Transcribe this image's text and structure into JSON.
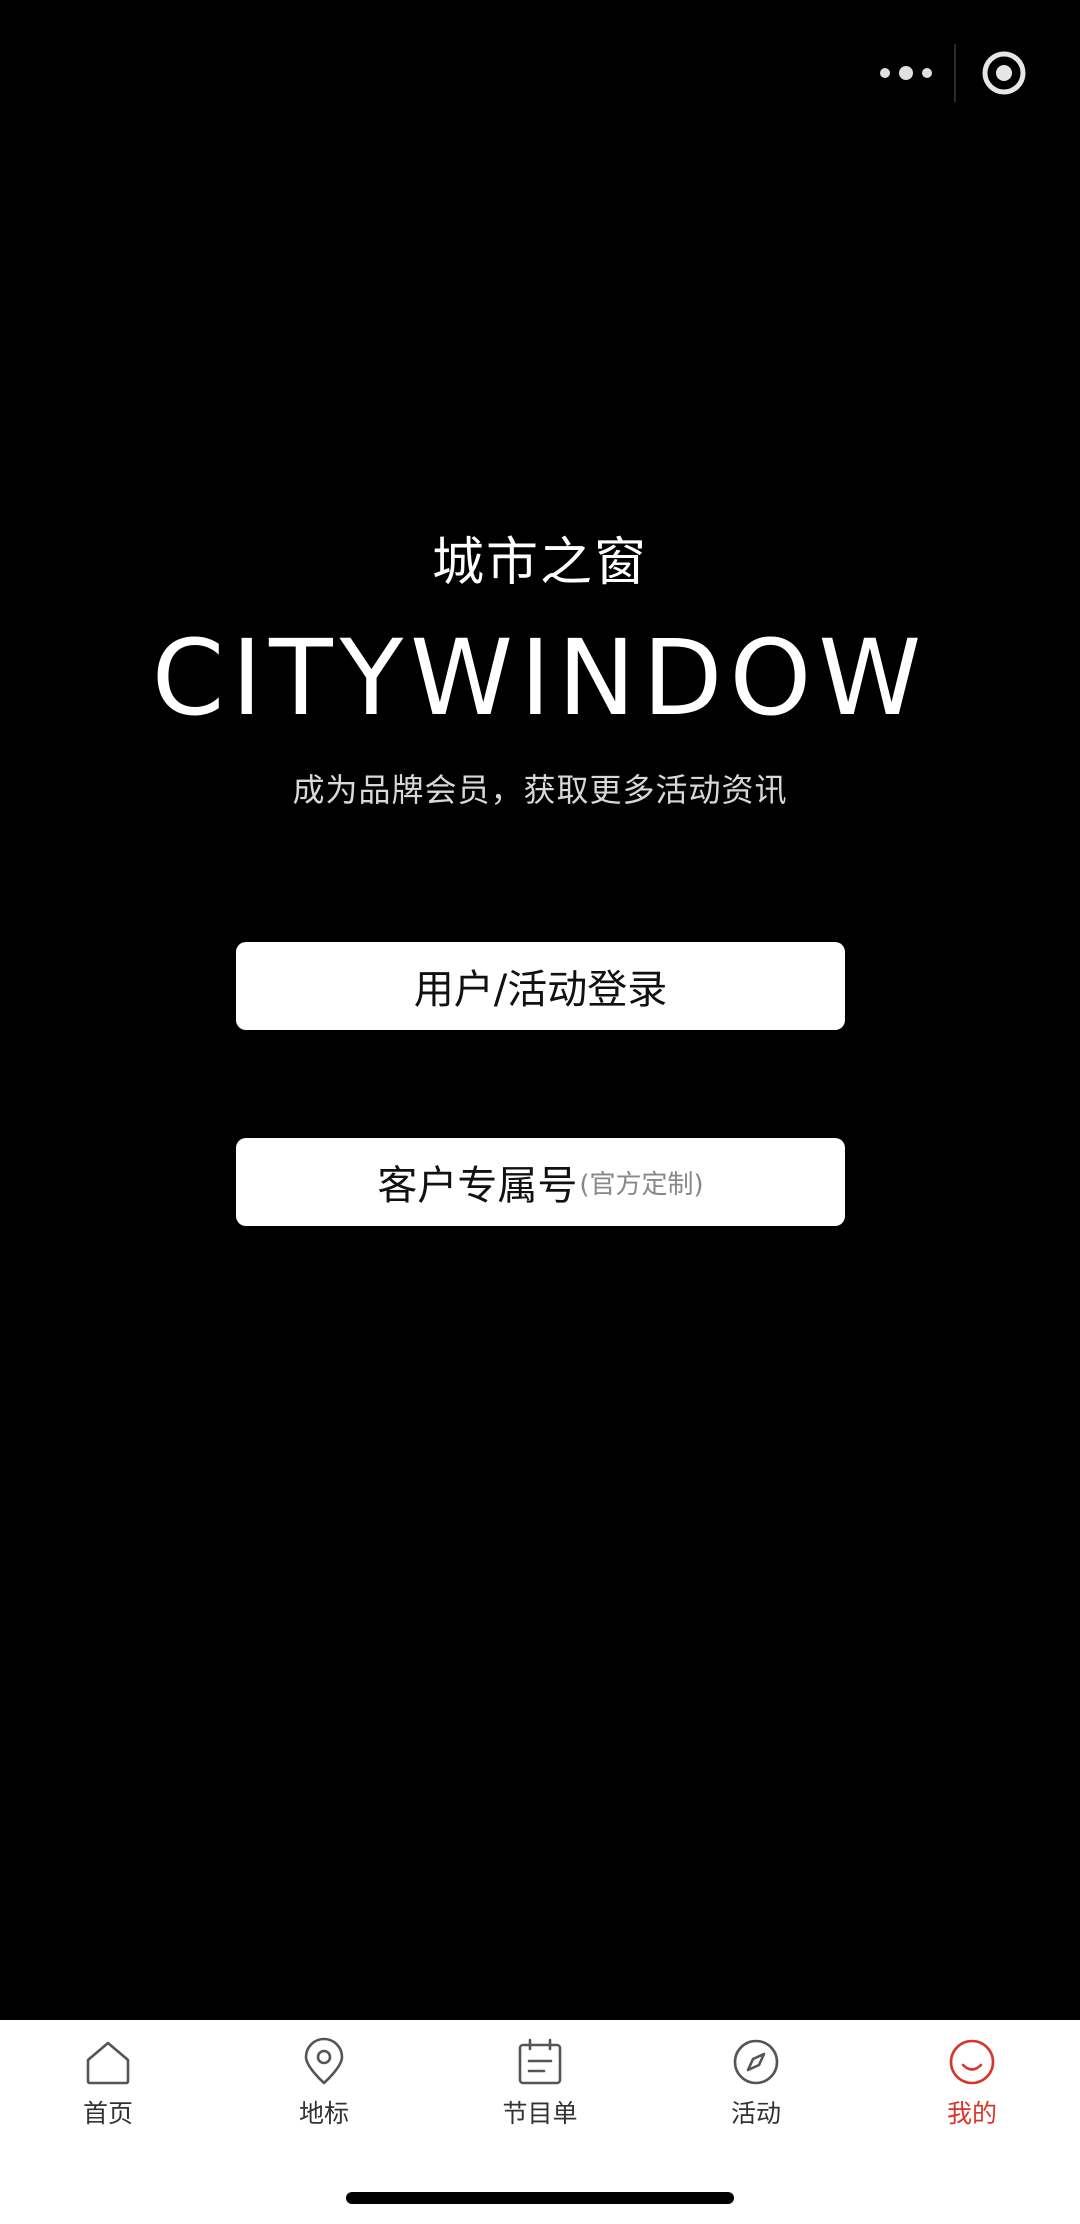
{
  "capsule": {
    "more_icon": "more-dots-icon",
    "close_icon": "target-close-icon"
  },
  "hero": {
    "brand_cn": "城市之窗",
    "brand_en": "CITYWINDOW",
    "tagline": "成为品牌会员，获取更多活动资讯"
  },
  "buttons": {
    "login_label": "用户/活动登录",
    "customer_label": "客户专属号",
    "customer_sub": "(官方定制)"
  },
  "tabbar": {
    "active_color": "#d8352b",
    "inactive_color": "#333333",
    "items": [
      {
        "label": "首页",
        "icon": "home-icon"
      },
      {
        "label": "地标",
        "icon": "location-pin-icon"
      },
      {
        "label": "节目单",
        "icon": "calendar-list-icon"
      },
      {
        "label": "活动",
        "icon": "compass-icon"
      },
      {
        "label": "我的",
        "icon": "smile-profile-icon"
      }
    ]
  }
}
